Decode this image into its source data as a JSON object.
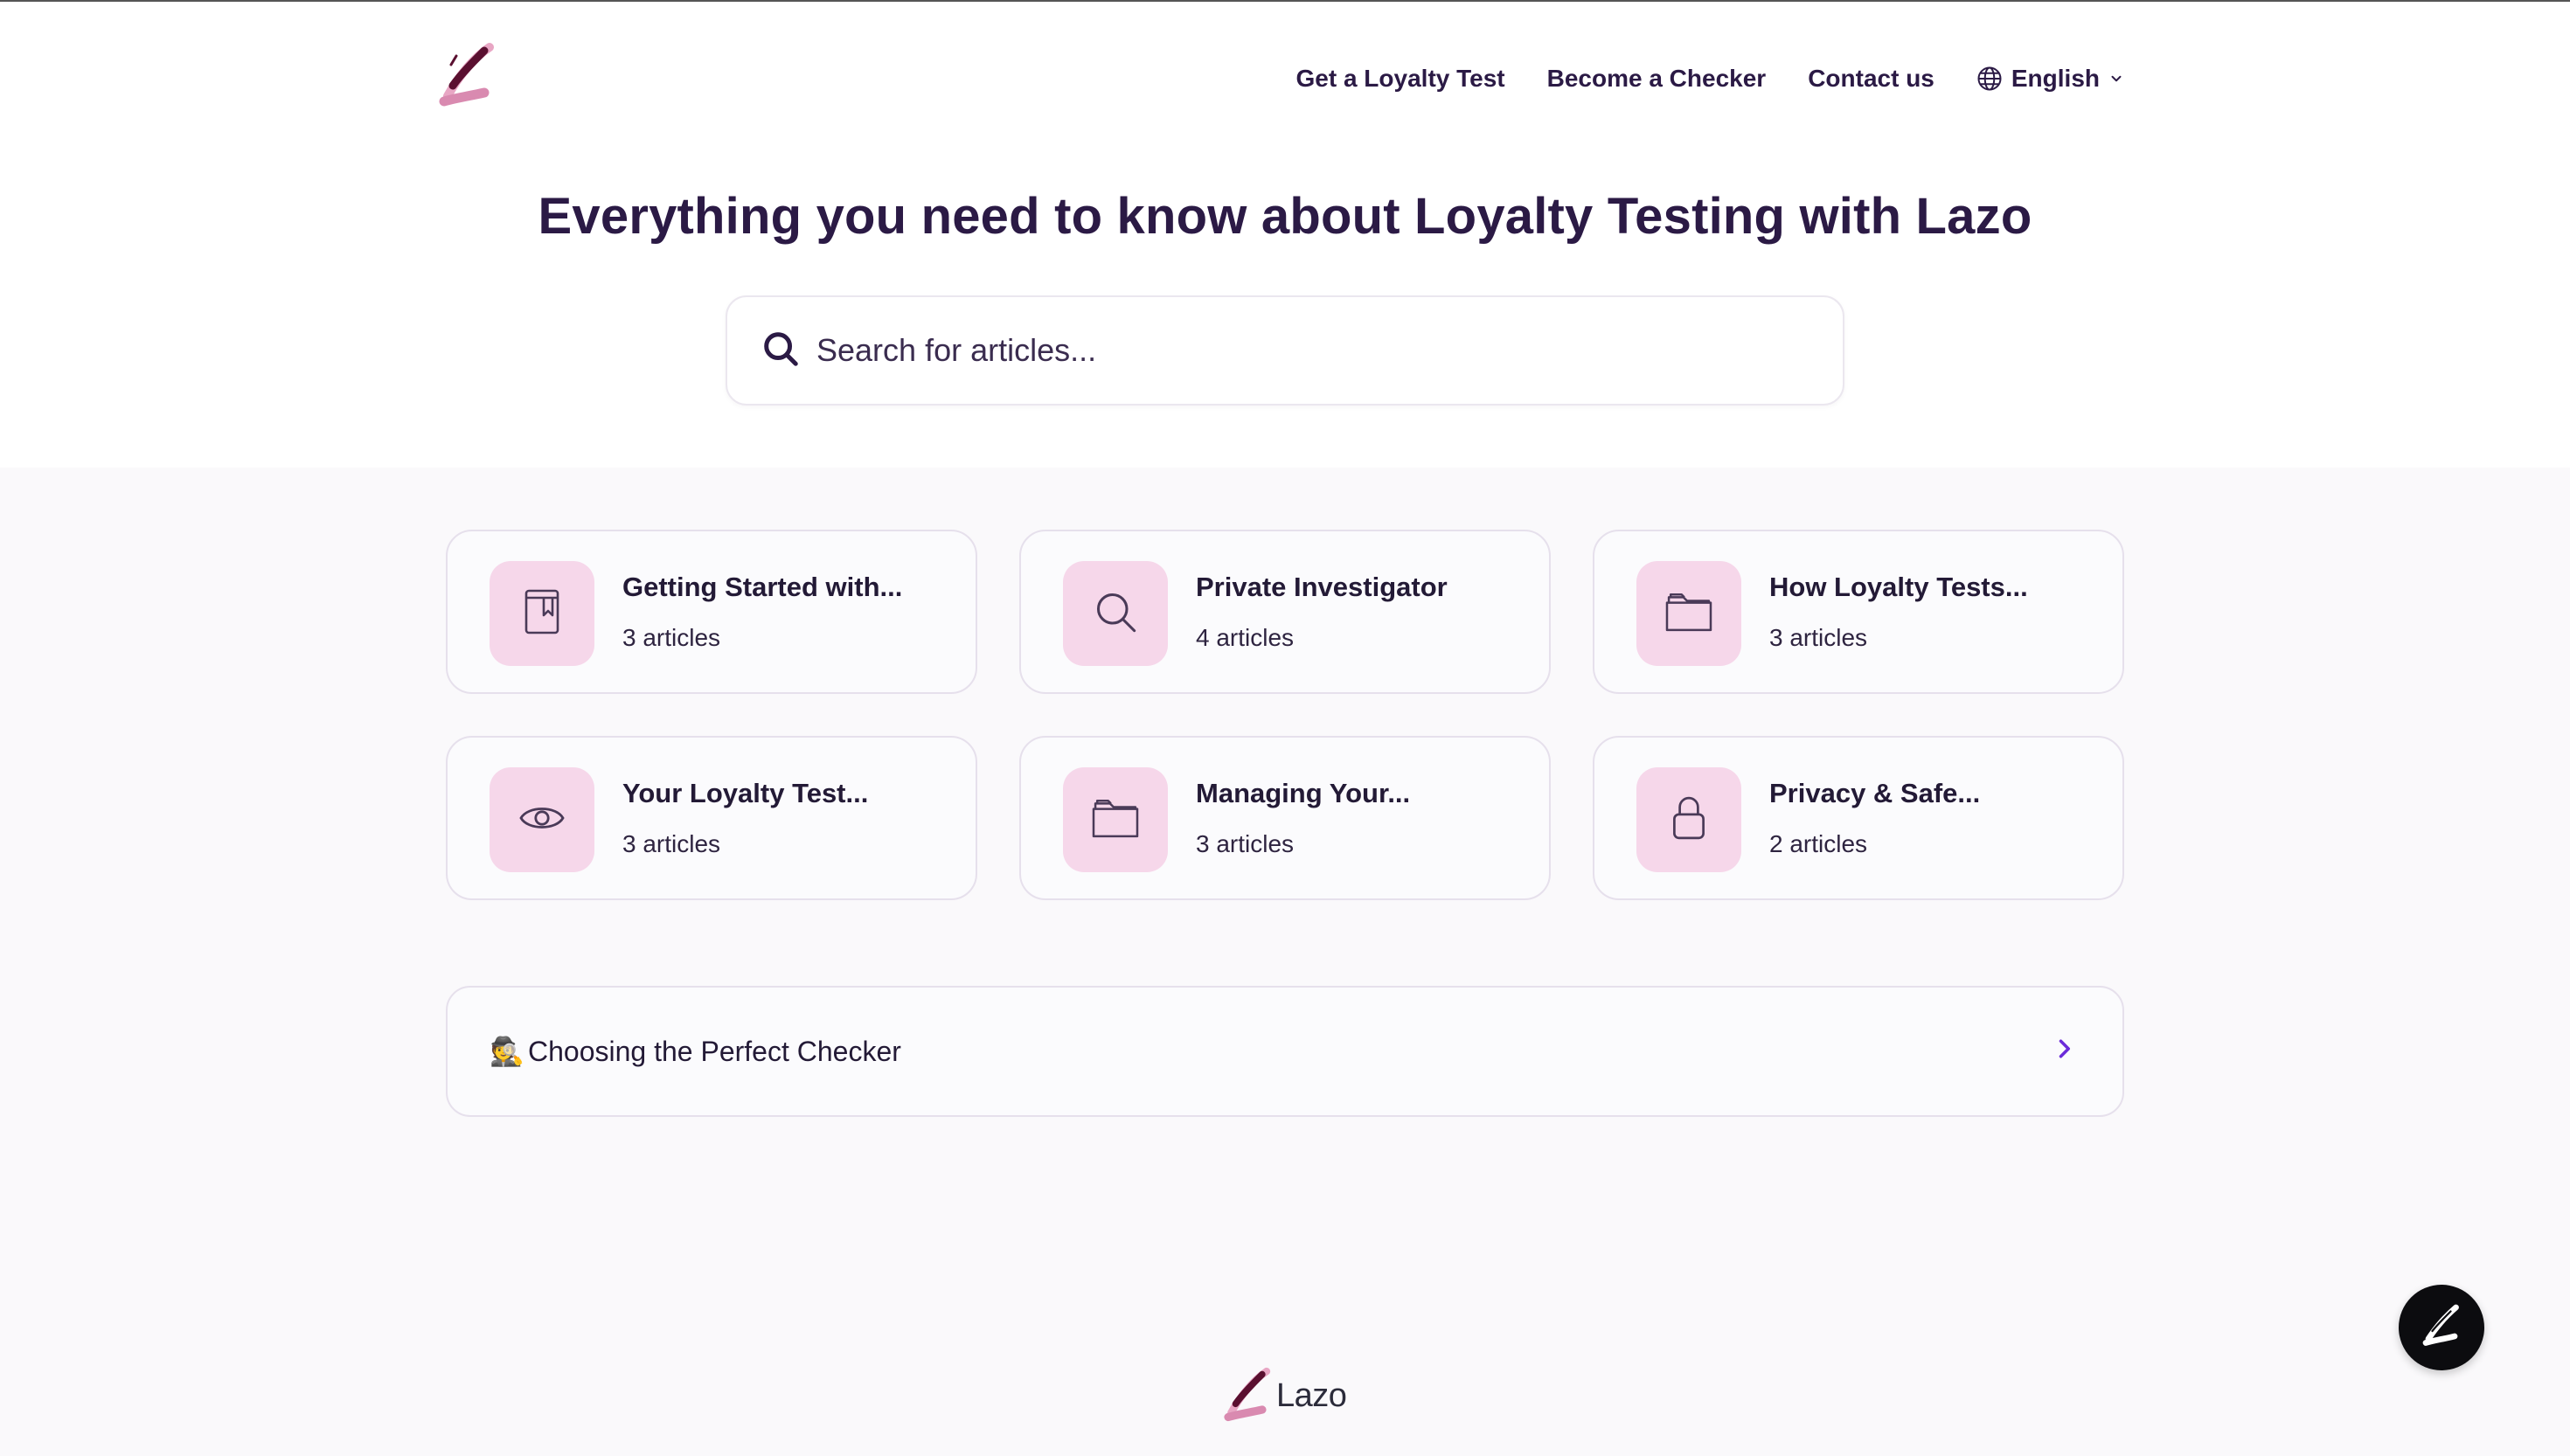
{
  "header": {
    "logo_icon": "lazo-brush-logo",
    "nav": [
      {
        "label": "Get a Loyalty Test"
      },
      {
        "label": "Become a Checker"
      },
      {
        "label": "Contact us"
      }
    ],
    "language": {
      "label": "English",
      "icon": "globe-icon"
    }
  },
  "hero": {
    "title": "Everything you need to know about Loyalty Testing with Lazo",
    "search": {
      "placeholder": "Search for articles...",
      "value": ""
    }
  },
  "collections": [
    {
      "title": "Getting Started with...",
      "count": "3 articles",
      "icon": "book-bookmark-icon"
    },
    {
      "title": "Private Investigator",
      "count": "4 articles",
      "icon": "search-icon"
    },
    {
      "title": "How Loyalty Tests...",
      "count": "3 articles",
      "icon": "folder-icon"
    },
    {
      "title": "Your Loyalty Test...",
      "count": "3 articles",
      "icon": "eye-icon"
    },
    {
      "title": "Managing Your...",
      "count": "3 articles",
      "icon": "folder-icon"
    },
    {
      "title": "Privacy & Safe...",
      "count": "2 articles",
      "icon": "lock-icon"
    }
  ],
  "featured_article": {
    "emoji": "🕵️",
    "title": "Choosing the Perfect Checker"
  },
  "footer": {
    "brand": "Lazo"
  },
  "colors": {
    "text": "#2b1a45",
    "icon_bg": "#f6d7ea",
    "page_bg": "#faf9fb",
    "chat_button": "#0c0c0f",
    "accent": "#6b2bd9"
  }
}
